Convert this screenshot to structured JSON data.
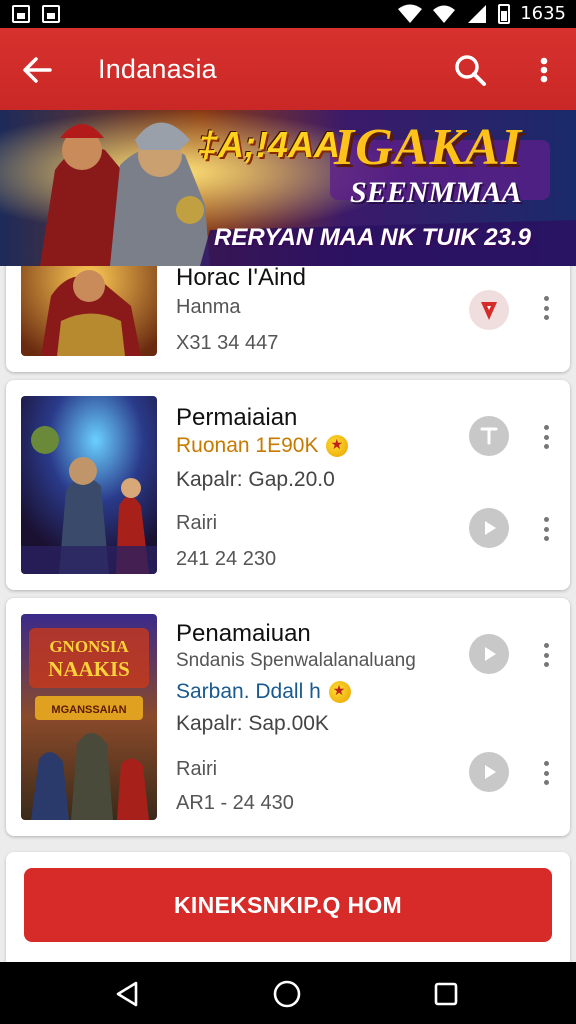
{
  "status_bar": {
    "time": "1635"
  },
  "app_bar": {
    "title": "Indanasia"
  },
  "banner": {
    "text_a": "&#x2A;A;!4AA!",
    "text_b": "IGAKAI",
    "text_c": "SEENMMAA",
    "text_d": "RERYAN MAA  NK TUIK 23.9"
  },
  "cards": [
    {
      "title": "Horac I'Aind",
      "sub": "Hanma",
      "nums": "X31  34 447"
    },
    {
      "title": "Permaiaian",
      "highlight": "Ruonan 1E90K",
      "detail": "Kapalr: Gap.20.0",
      "sub": "Rairi",
      "nums": "241  24 230"
    },
    {
      "title": "Penamaiuan",
      "desc": "Sndanis Spenwalalanaluang",
      "highlight": "Sarban. Ddall h",
      "detail": "Kapalr: Sap.00K",
      "sub": "Rairi",
      "nums": "AR1 - 24 430"
    }
  ],
  "thumb_art": {
    "card3_title_1": "GNONSIA",
    "card3_title_2": "NAAKIS",
    "card3_banner": "MGANSSAIAN"
  },
  "bottom": {
    "button_label": "KINEKSNKIP.Q  HOM"
  },
  "icons": [
    "back-arrow-icon",
    "search-icon",
    "more-vert-icon",
    "play-icon",
    "download-icon",
    "nav-back-icon",
    "nav-home-icon",
    "nav-recents-icon"
  ],
  "colors": {
    "accent": "#d62b28",
    "appbar": "#c92826"
  }
}
